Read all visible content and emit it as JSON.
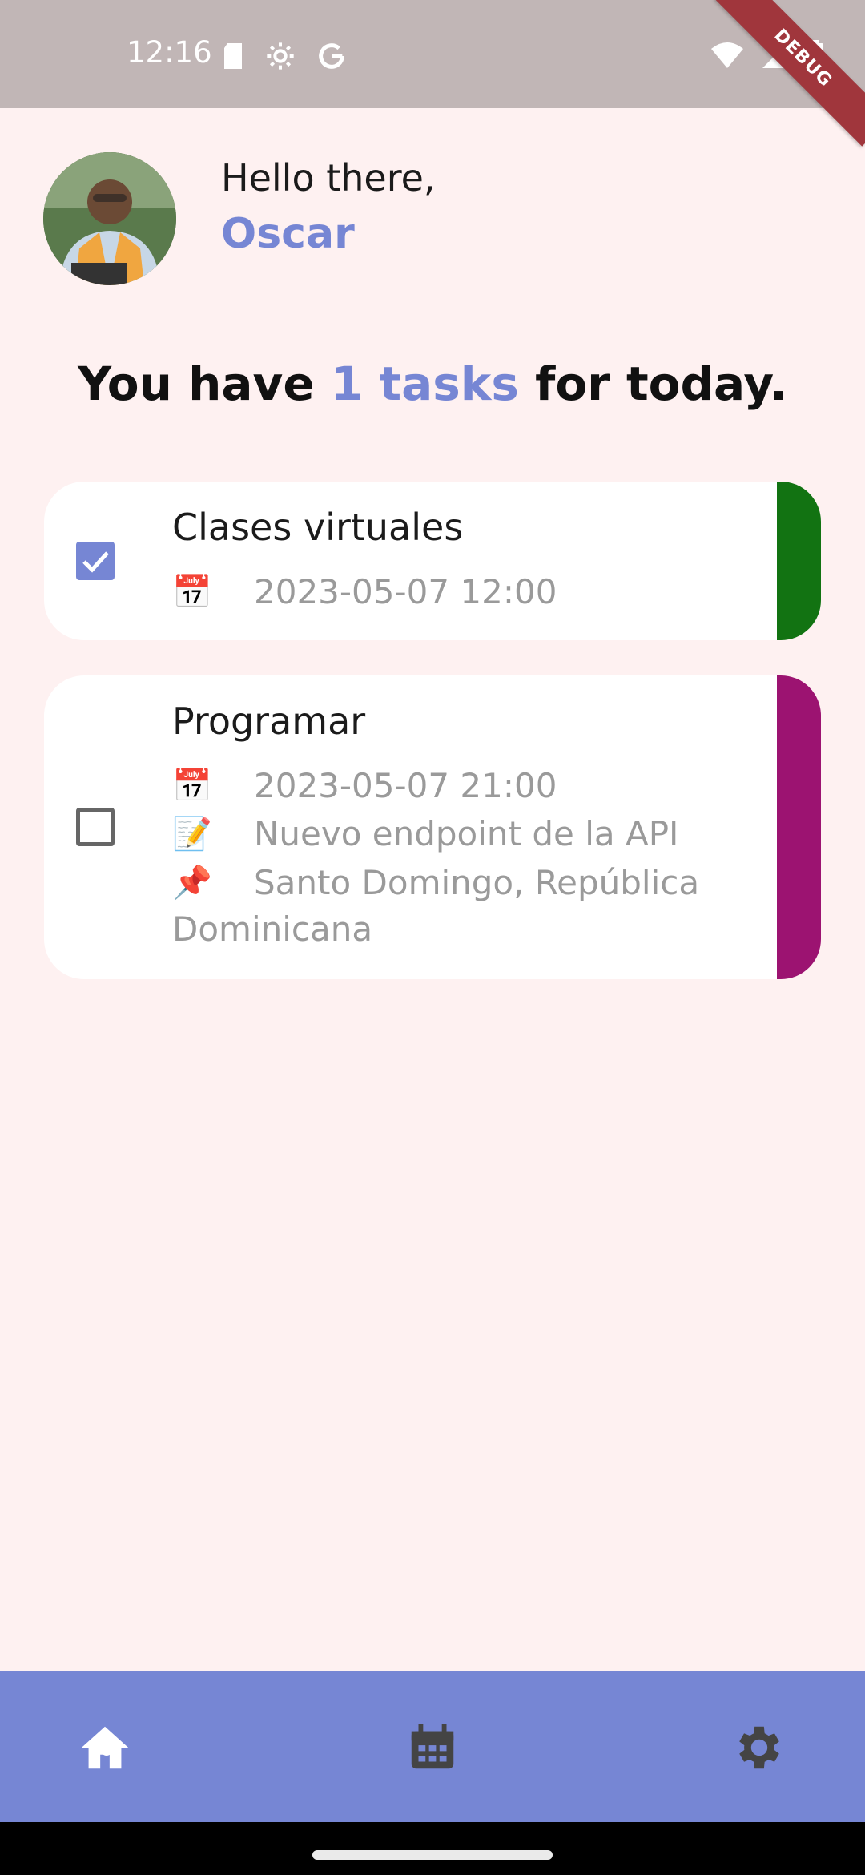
{
  "status_bar": {
    "time": "12:16",
    "left_icons": [
      "sd-card-icon",
      "settings-gear-icon",
      "google-icon"
    ],
    "right_icons": [
      "wifi-icon",
      "signal-icon",
      "battery-icon"
    ],
    "debug_label": "DEBUG"
  },
  "header": {
    "greeting": "Hello there,",
    "user_name": "Oscar"
  },
  "summary": {
    "prefix": "You have ",
    "count": "1 tasks",
    "suffix": " for today."
  },
  "tasks": [
    {
      "title": "Clases virtuales",
      "checked": true,
      "date": "2023-05-07 12:00",
      "color": "#127312"
    },
    {
      "title": "Programar",
      "checked": false,
      "date": "2023-05-07 21:00",
      "note": "Nuevo endpoint de la API",
      "location_line1": "Santo Domingo, República",
      "location_line2": "Dominicana",
      "color": "#9c1371"
    }
  ],
  "bottom_nav": {
    "items": [
      "home-icon",
      "calendar-icon",
      "settings-icon"
    ],
    "active": "home-icon",
    "background": "#7686d4"
  },
  "colors": {
    "accent": "#7686d4",
    "page_bg": "#fef1f1",
    "status_bar": "#c1b6b6"
  }
}
